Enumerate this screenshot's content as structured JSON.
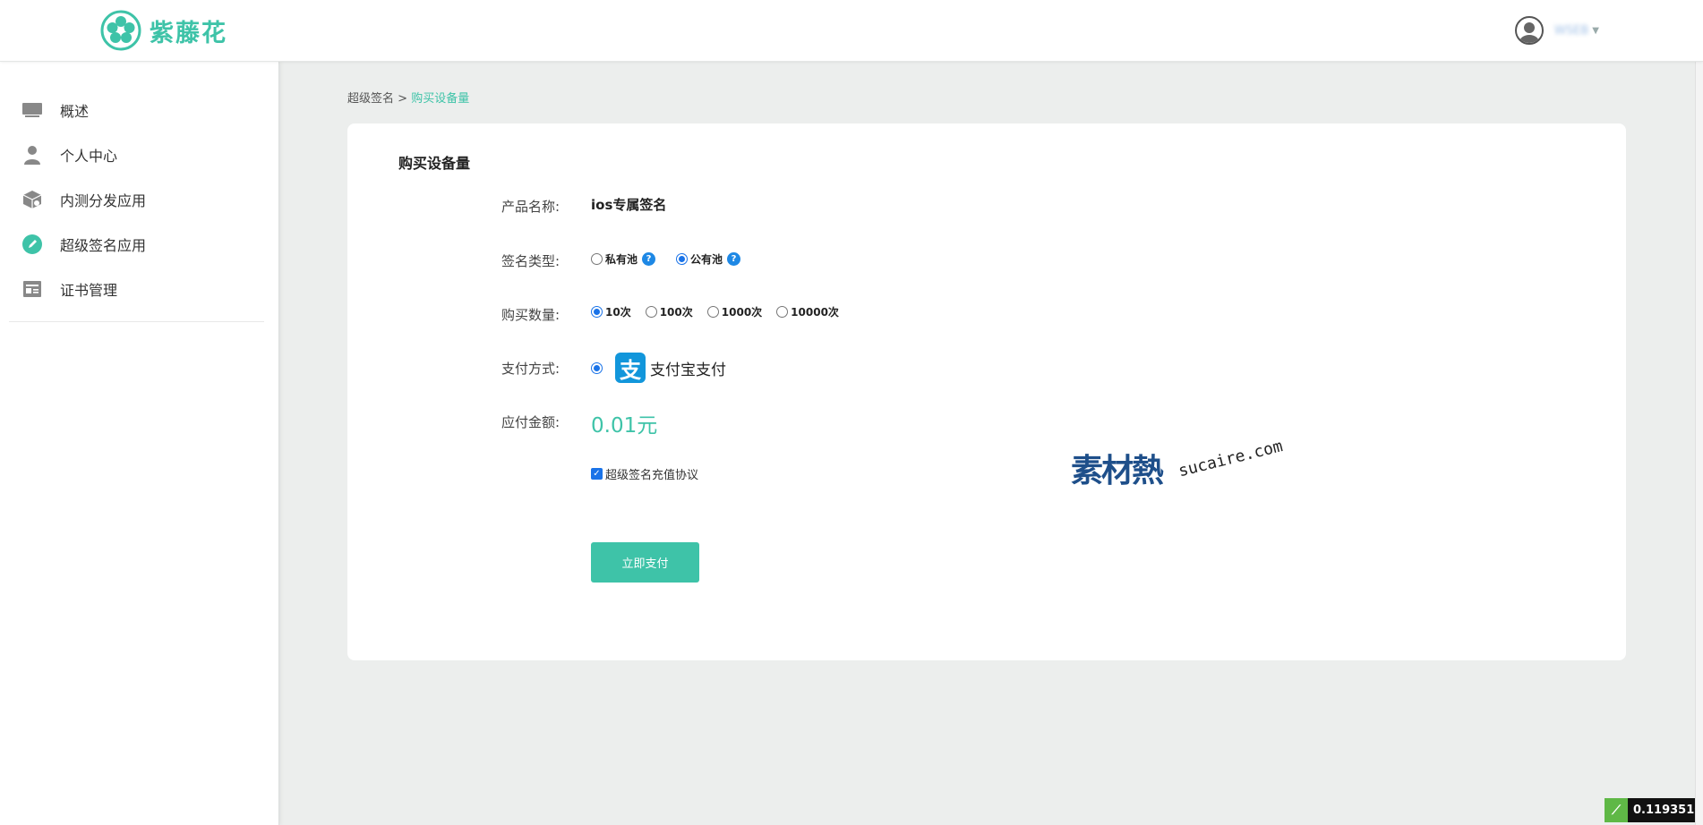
{
  "header": {
    "brand_name": "紫藤花",
    "username": "WSEB",
    "accent_color": "#3ec3a8"
  },
  "sidebar": {
    "items": [
      {
        "label": "概述",
        "icon": "monitor-icon"
      },
      {
        "label": "个人中心",
        "icon": "person-icon"
      },
      {
        "label": "内测分发应用",
        "icon": "package-icon"
      },
      {
        "label": "超级签名应用",
        "icon": "pen-icon"
      },
      {
        "label": "证书管理",
        "icon": "certificate-icon"
      }
    ]
  },
  "breadcrumb": {
    "parent": "超级签名",
    "separator": ">",
    "current": "购买设备量"
  },
  "form": {
    "title": "购买设备量",
    "product_label": "产品名称:",
    "product_value": "ios专属签名",
    "sign_type_label": "签名类型:",
    "sign_types": [
      {
        "label": "私有池",
        "checked": false,
        "help": "?"
      },
      {
        "label": "公有池",
        "checked": true,
        "help": "?"
      }
    ],
    "quantity_label": "购买数量:",
    "quantities": [
      {
        "label": "10次",
        "checked": true
      },
      {
        "label": "100次",
        "checked": false
      },
      {
        "label": "1000次",
        "checked": false
      },
      {
        "label": "10000次",
        "checked": false
      }
    ],
    "payment_label": "支付方式:",
    "payment_method": "支付宝支付",
    "payment_logo_char": "支",
    "amount_label": "应付金额:",
    "amount_value": "0.01元",
    "agreement_label": "超级签名充值协议",
    "agreement_checked": true,
    "submit_label": "立即支付"
  },
  "watermark": {
    "cn": "素材熱",
    "en": "sucaire.com"
  },
  "timer": {
    "value": "0.119351s"
  }
}
